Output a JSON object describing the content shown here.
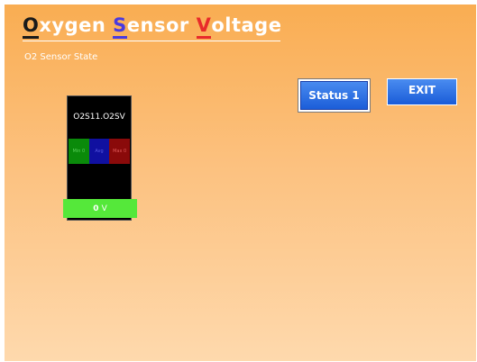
{
  "title": {
    "parts": [
      {
        "initial": "O",
        "rest": "xygen ",
        "color": "#1a1a1a"
      },
      {
        "initial": "S",
        "rest": "ensor ",
        "color": "#4a3adf"
      },
      {
        "initial": "V",
        "rest": "oltage",
        "color": "#e82a2a"
      }
    ]
  },
  "subtitle": "O2 Sensor State",
  "buttons": {
    "status_label": "Status 1",
    "exit_label": "EXIT"
  },
  "gauge": {
    "label": "O2S11.O2SV",
    "min_label": "Min",
    "min_value": "0",
    "mid_label": "Avg",
    "max_label": "Max",
    "max_value": "0",
    "value": "0",
    "unit": "V"
  },
  "colors": {
    "button": "#2a6ae4",
    "value_box": "#55e83a",
    "band_min": "#0a8a0a",
    "band_mid": "#1010a0",
    "band_max": "#8a0a0a"
  }
}
